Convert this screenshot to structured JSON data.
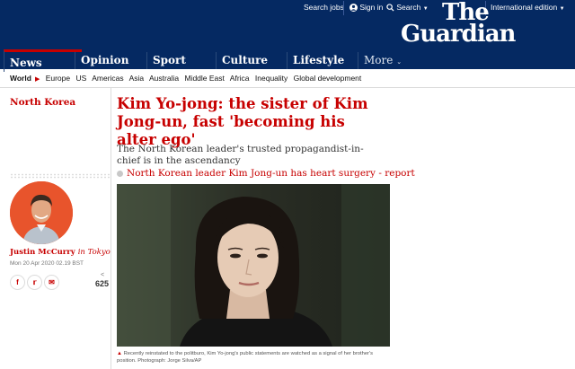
{
  "header": {
    "search_jobs": "Search jobs",
    "sign_in": "Sign in",
    "search": "Search",
    "edition": "International edition",
    "logo_line1": "The",
    "logo_line2": "Guardian"
  },
  "nav": {
    "pillars": [
      {
        "label": "News"
      },
      {
        "label": "Opinion"
      },
      {
        "label": "Sport"
      },
      {
        "label": "Culture"
      },
      {
        "label": "Lifestyle"
      },
      {
        "label": "More"
      }
    ],
    "subnav": {
      "current": "World",
      "items": [
        "Europe",
        "US",
        "Americas",
        "Asia",
        "Australia",
        "Middle East",
        "Africa",
        "Inequality",
        "Global development"
      ]
    }
  },
  "article": {
    "section": "North Korea",
    "headline": "Kim Yo-jong: the sister of Kim Jong-un, fast 'becoming his alter ego'",
    "standfirst": "The North Korean leader's trusted propagandist-in-chief is in the ascendancy",
    "related": "North Korean leader Kim Jong-un has heart surgery - report",
    "author_name": "Justin McCurry",
    "author_location": "in Tokyo",
    "dateline": "Mon 20 Apr 2020 02.19 BST",
    "share_count": "625",
    "caption": "Recently reinstated to the politburo, Kim Yo-jong's public statements are watched as a signal of her brother's position. Photograph: Jorge Silva/AP"
  },
  "colors": {
    "brand_blue": "#052962",
    "news_red": "#c70000"
  },
  "icons": [
    "user-icon",
    "search-icon",
    "chevron-down-icon",
    "facebook-icon",
    "twitter-icon",
    "email-icon",
    "share-icon"
  ]
}
